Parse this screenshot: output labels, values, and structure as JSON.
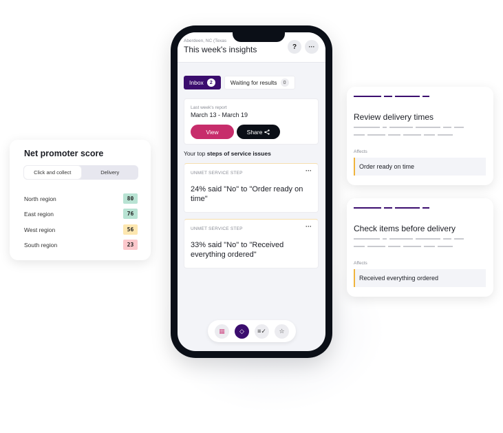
{
  "phone": {
    "location": "Aberdeen, NC (Texas",
    "title": "This week's insights",
    "help_label": "?",
    "more_label": "···",
    "tabs": [
      {
        "label": "Inbox",
        "count": "2",
        "active": true
      },
      {
        "label": "Waiting for results",
        "count": "0",
        "active": false
      }
    ],
    "report": {
      "label": "Last week's report",
      "dates": "March 13 - March 19",
      "view_label": "View",
      "share_label": "Share",
      "share_icon": "⋖"
    },
    "section_prefix": "Your top ",
    "section_bold": "steps of service issues",
    "issues": [
      {
        "kicker": "UNMET SERVICE STEP",
        "menu": "···",
        "text": "24% said \"No\" to \"Order ready on time\""
      },
      {
        "kicker": "UNMET SERVICE STEP",
        "menu": "···",
        "text": "33% said \"No\" to \"Received everything ordered\""
      }
    ],
    "bottom_nav": [
      {
        "name": "calendar-icon",
        "glyph": "▦",
        "active": false
      },
      {
        "name": "alert-diamond-icon",
        "glyph": "◇",
        "active": true
      },
      {
        "name": "checklist-icon",
        "glyph": "≡✓",
        "active": false
      },
      {
        "name": "star-icon",
        "glyph": "☆",
        "active": false
      }
    ]
  },
  "nps": {
    "title": "Net promoter score",
    "segments": [
      "Click and collect",
      "Delivery"
    ],
    "selected_segment": "Click and collect",
    "rows": [
      {
        "label": "North region",
        "value": "80",
        "color": "#b8e3d3"
      },
      {
        "label": "East region",
        "value": "76",
        "color": "#b8e3d3"
      },
      {
        "label": "West region",
        "value": "56",
        "color": "#fde7b0"
      },
      {
        "label": "South region",
        "value": "23",
        "color": "#fcc8cc"
      }
    ]
  },
  "actions": [
    {
      "title": "Review delivery times",
      "affects_label": "Affects",
      "affects": "Order ready on time"
    },
    {
      "title": "Check items before delivery",
      "affects_label": "Affects",
      "affects": "Received everything ordered"
    }
  ],
  "colors": {
    "brand_purple": "#3b0d6e",
    "view_pink": "#c72d6b",
    "accent_yellow": "#f0b43c"
  }
}
